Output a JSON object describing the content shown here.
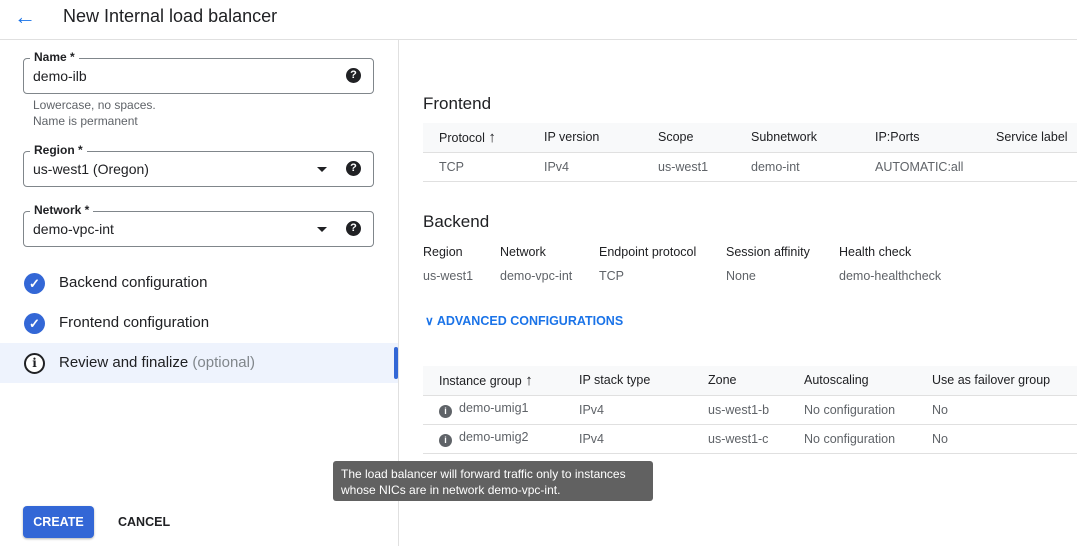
{
  "header": {
    "title": "New Internal load balancer"
  },
  "form": {
    "name": {
      "label": "Name *",
      "value": "demo-ilb",
      "hint1": "Lowercase, no spaces.",
      "hint2": "Name is permanent"
    },
    "region": {
      "label": "Region *",
      "value": "us-west1 (Oregon)"
    },
    "network": {
      "label": "Network *",
      "value": "demo-vpc-int"
    }
  },
  "steps": [
    {
      "label": "Backend configuration",
      "status": "done"
    },
    {
      "label": "Frontend configuration",
      "status": "done"
    },
    {
      "label": "Review and finalize",
      "optional": "(optional)",
      "status": "active"
    }
  ],
  "frontend": {
    "title": "Frontend",
    "headers": [
      "Protocol",
      "IP version",
      "Scope",
      "Subnetwork",
      "IP:Ports",
      "Service label"
    ],
    "rows": [
      [
        "TCP",
        "IPv4",
        "us-west1",
        "demo-int",
        "AUTOMATIC:all",
        ""
      ]
    ]
  },
  "backend": {
    "title": "Backend",
    "fields": [
      {
        "k": "Region",
        "v": "us-west1"
      },
      {
        "k": "Network",
        "v": "demo-vpc-int"
      },
      {
        "k": "Endpoint protocol",
        "v": "TCP"
      },
      {
        "k": "Session affinity",
        "v": "None"
      },
      {
        "k": "Health check",
        "v": "demo-healthcheck"
      }
    ]
  },
  "advanced": "ADVANCED CONFIGURATIONS",
  "instances": {
    "headers": [
      "Instance group",
      "IP stack type",
      "Zone",
      "Autoscaling",
      "Use as failover group"
    ],
    "rows": [
      [
        "demo-umig1",
        "IPv4",
        "us-west1-b",
        "No configuration",
        "No"
      ],
      [
        "demo-umig2",
        "IPv4",
        "us-west1-c",
        "No configuration",
        "No"
      ]
    ]
  },
  "tooltip": "The load balancer will forward traffic only to instances whose NICs are in network demo-vpc-int.",
  "buttons": {
    "create": "CREATE",
    "cancel": "CANCEL"
  },
  "colors": {
    "accent": "#3367d6",
    "link": "#1a73e8"
  }
}
